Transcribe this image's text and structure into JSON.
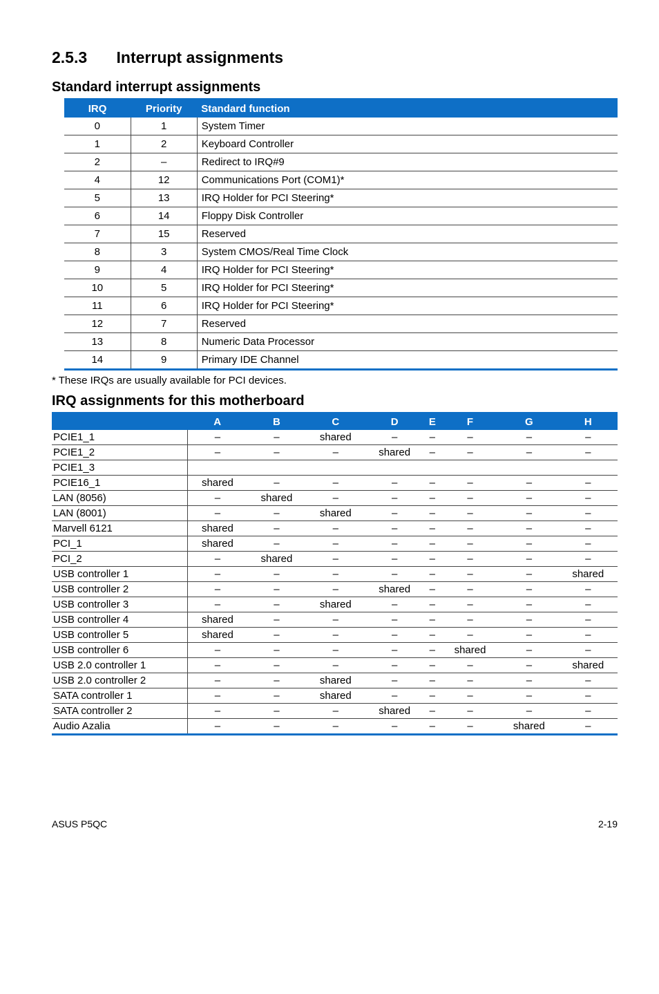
{
  "heading": {
    "number": "2.5.3",
    "title": "Interrupt assignments"
  },
  "table1": {
    "title": "Standard interrupt assignments",
    "headers": [
      "IRQ",
      "Priority",
      "Standard function"
    ],
    "rows": [
      [
        "0",
        "1",
        "System Timer"
      ],
      [
        "1",
        "2",
        "Keyboard Controller"
      ],
      [
        "2",
        "–",
        "Redirect to IRQ#9"
      ],
      [
        "4",
        "12",
        "Communications Port (COM1)*"
      ],
      [
        "5",
        "13",
        "IRQ Holder for PCI Steering*"
      ],
      [
        "6",
        "14",
        "Floppy Disk Controller"
      ],
      [
        "7",
        "15",
        "Reserved"
      ],
      [
        "8",
        "3",
        "System CMOS/Real Time Clock"
      ],
      [
        "9",
        "4",
        "IRQ Holder for PCI Steering*"
      ],
      [
        "10",
        "5",
        "IRQ Holder for PCI Steering*"
      ],
      [
        "11",
        "6",
        "IRQ Holder for PCI Steering*"
      ],
      [
        "12",
        "7",
        "Reserved"
      ],
      [
        "13",
        "8",
        "Numeric Data Processor"
      ],
      [
        "14",
        "9",
        "Primary IDE Channel"
      ]
    ]
  },
  "note": "* These IRQs are usually available for PCI devices.",
  "table2": {
    "title": "IRQ assignments for this motherboard",
    "headers": [
      "",
      "A",
      "B",
      "C",
      "D",
      "E",
      "F",
      "G",
      "H"
    ],
    "rows": [
      [
        "PCIE1_1",
        "–",
        "–",
        "shared",
        "–",
        "–",
        "–",
        "–",
        "–"
      ],
      [
        "PCIE1_2",
        "–",
        "–",
        "–",
        "shared",
        "–",
        "–",
        "–",
        "–"
      ],
      [
        "PCIE1_3",
        "",
        "",
        "",
        "",
        "",
        "",
        "",
        ""
      ],
      [
        "PCIE16_1",
        "shared",
        "–",
        "–",
        "–",
        "–",
        "–",
        "–",
        "–"
      ],
      [
        "LAN (8056)",
        "–",
        "shared",
        "–",
        "–",
        "–",
        "–",
        "–",
        "–"
      ],
      [
        "LAN (8001)",
        "–",
        "–",
        "shared",
        "–",
        "–",
        "–",
        "–",
        "–"
      ],
      [
        "Marvell 6121",
        "shared",
        "–",
        "–",
        "–",
        "–",
        "–",
        "–",
        "–"
      ],
      [
        "PCI_1",
        "shared",
        "–",
        "–",
        "–",
        "–",
        "–",
        "–",
        "–"
      ],
      [
        "PCI_2",
        "–",
        "shared",
        "–",
        "–",
        "–",
        "–",
        "–",
        "–"
      ],
      [
        "USB controller 1",
        "–",
        "–",
        "–",
        "–",
        "–",
        "–",
        "–",
        "shared"
      ],
      [
        "USB controller 2",
        "–",
        "–",
        "–",
        "shared",
        "–",
        "–",
        "–",
        "–"
      ],
      [
        "USB controller 3",
        "–",
        "–",
        "shared",
        "–",
        "–",
        "–",
        "–",
        "–"
      ],
      [
        "USB controller 4",
        "shared",
        "–",
        "–",
        "–",
        "–",
        "–",
        "–",
        "–"
      ],
      [
        "USB controller 5",
        "shared",
        "–",
        "–",
        "–",
        "–",
        "–",
        "–",
        "–"
      ],
      [
        "USB controller 6",
        "–",
        "–",
        "–",
        "–",
        "–",
        "shared",
        "–",
        "–"
      ],
      [
        "USB 2.0 controller 1",
        "–",
        "–",
        "–",
        "–",
        "–",
        "–",
        "–",
        "shared"
      ],
      [
        "USB 2.0 controller 2",
        "–",
        "–",
        "shared",
        "–",
        "–",
        "–",
        "–",
        "–"
      ],
      [
        "SATA controller 1",
        "–",
        "–",
        "shared",
        "–",
        "–",
        "–",
        "–",
        "–"
      ],
      [
        "SATA controller 2",
        "–",
        "–",
        "–",
        "shared",
        "–",
        "–",
        "–",
        "–"
      ],
      [
        "Audio Azalia",
        "–",
        "–",
        "–",
        "–",
        "–",
        "–",
        "shared",
        "–"
      ]
    ]
  },
  "footer": {
    "left": "ASUS P5QC",
    "right": "2-19"
  }
}
